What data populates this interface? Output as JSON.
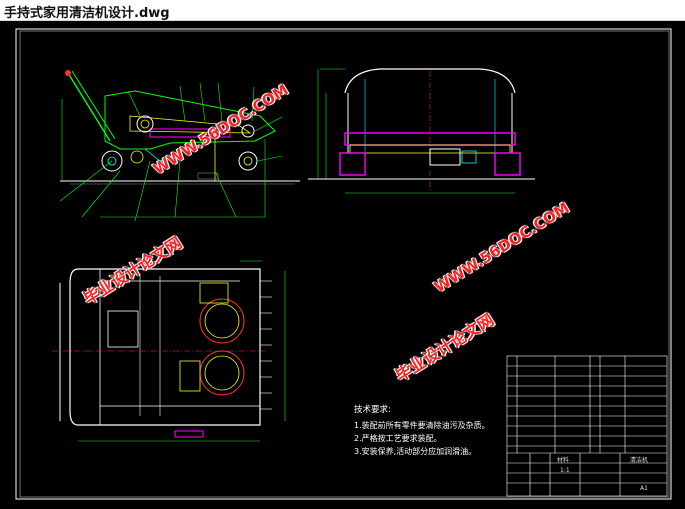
{
  "window": {
    "title": "手持式家用清洁机设计.dwg"
  },
  "drawing": {
    "background": "#000000",
    "colors": {
      "frame": "#ffffff",
      "outline": "#00ff00",
      "part": "#ffff00",
      "accent": "#ff00ff",
      "cyan": "#00ffff",
      "red": "#ff3030"
    },
    "technical_requirements": {
      "heading": "技术要求:",
      "items": [
        "1.装配前所有零件要清除油污及杂质。",
        "2.严格按工艺要求装配。",
        "3.安装保养,活动部分应加润滑油。"
      ]
    },
    "title_block": {
      "material": "材料",
      "scale": "1:1",
      "drawing_name": "清洁机",
      "sheet": "A1"
    }
  },
  "watermarks": {
    "url": "WWW.56DOC.COM",
    "cn": "毕业设计论文网"
  }
}
